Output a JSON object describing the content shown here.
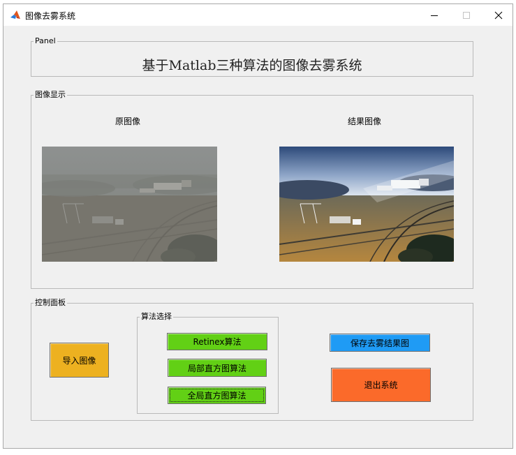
{
  "window": {
    "title": "图像去雾系统"
  },
  "header_panel": {
    "legend": "Panel",
    "title": "基于Matlab三种算法的图像去雾系统"
  },
  "display_panel": {
    "legend": "图像显示",
    "original_label": "原图像",
    "result_label": "结果图像"
  },
  "control_panel": {
    "legend": "控制面板",
    "import_button": "导入图像",
    "algorithm_group": {
      "legend": "算法选择",
      "retinex_button": "Retinex算法",
      "local_hist_button": "局部直方图算法",
      "global_hist_button": "全局直方图算法"
    },
    "save_button": "保存去雾结果图",
    "exit_button": "退出系统"
  },
  "colors": {
    "import_button": "#edb120",
    "algorithm_buttons": "#62d015",
    "save_button": "#1f9bf5",
    "exit_button": "#fb6a2a",
    "display_legend": "#1d6b3a"
  },
  "icons": {
    "app": "matlab-icon",
    "minimize": "minimize-icon",
    "maximize": "maximize-icon",
    "close": "close-icon"
  }
}
